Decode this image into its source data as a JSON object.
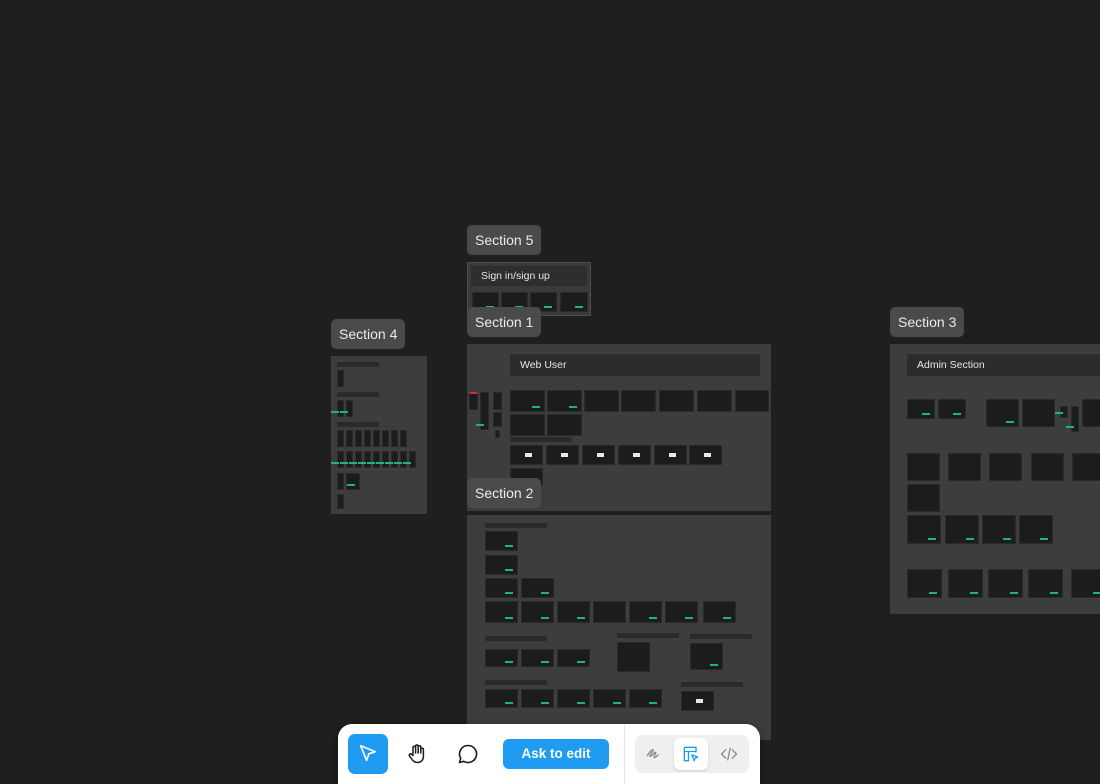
{
  "sections": {
    "section5": {
      "label": "Section 5",
      "frame_title": "Sign in/sign up"
    },
    "section1": {
      "label": "Section 1",
      "frame_title": "Web User"
    },
    "section4": {
      "label": "Section 4"
    },
    "section3": {
      "label": "Section 3",
      "frame_title": "Admin Section"
    },
    "section2": {
      "label": "Section 2"
    }
  },
  "toolbar": {
    "ask_to_edit_label": "Ask to edit",
    "tools": [
      "pointer-icon",
      "hand-icon",
      "comment-icon"
    ],
    "mode_tools": [
      "draw-icon",
      "design-mode-icon",
      "code-icon"
    ]
  },
  "colors": {
    "canvas_background": "#1f1e20",
    "section_fill": "#3d3c3f",
    "label_fill": "#4a494c",
    "accent": "#1f9bf2",
    "thumbnail_accent": "#1fb57a"
  }
}
